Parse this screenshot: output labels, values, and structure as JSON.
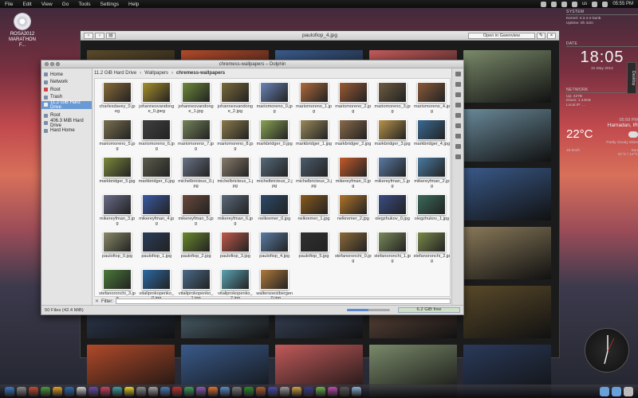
{
  "menubar": {
    "items": [
      "File",
      "Edit",
      "View",
      "Go",
      "Tools",
      "Settings",
      "Help"
    ],
    "kbd_layout": "us",
    "clock": "05:55 PM"
  },
  "desktop_icon": {
    "label": "ROSA2012 MARATHON F..."
  },
  "gwenview": {
    "title": "paulofiop_4.jpg",
    "open_button": "Open in Gwenview"
  },
  "dolphin": {
    "title": "chremess-wallpapers – Dolphin",
    "places": [
      {
        "label": "Home",
        "selected": false
      },
      {
        "label": "Network",
        "selected": false
      },
      {
        "label": "Root",
        "selected": false
      },
      {
        "label": "Trash",
        "selected": false
      },
      {
        "label": "11.2 GiB Hard Drive",
        "selected": true
      },
      {
        "label": "Root",
        "selected": false
      },
      {
        "label": "406.3 MiB Hard Drive",
        "selected": false
      },
      {
        "label": "Hard Home",
        "selected": false
      }
    ],
    "breadcrumb": [
      "11.2 GiB Hard Drive",
      "Wallpapers",
      "chremess-wallpapers"
    ],
    "files": [
      "charlesdavey_0.jpeg",
      "johannesvandonge_0.jpeg",
      "johannesvandonge_1.jpg",
      "johannesvandonge_2.jpg",
      "mariomoreno_0.jpg",
      "mariomoreno_1.jpg",
      "mariomoreno_2.jpg",
      "mariomoreno_3.jpg",
      "mariomoreno_4.jpg",
      "mariomoreno_5.jpg",
      "mariomoreno_6.jpg",
      "mariomoreno_7.jpg",
      "mariomoreno_8.jpg",
      "markbridger_0.jpg",
      "markbridger_1.jpg",
      "markbridger_2.jpg",
      "markbridger_3.jpg",
      "markbridger_4.jpg",
      "markbridger_5.jpg",
      "markbridger_6.jpg",
      "michelbricteux_0.jpg",
      "michelbricteux_1.jpg",
      "michelbricteux_2.jpg",
      "michelbricteux_3.jpg",
      "mikereyfman_0.jpg",
      "mikereyfman_1.jpg",
      "mikereyfman_2.jpg",
      "mikereyfman_3.jpg",
      "mikereyfman_4.jpg",
      "mikereyfman_5.jpg",
      "mikereyfman_6.jpg",
      "nelkremer_0.jpg",
      "nelkremer_1.jpg",
      "nelkremer_2.jpg",
      "olegzhukov_0.jpg",
      "olegzhukov_1.jpg",
      "paulofiop_0.jpg",
      "paulofiop_1.jpg",
      "paulofiop_2.jpg",
      "paulofiop_3.jpg",
      "paulofiop_4.jpg",
      "paulofiop_5.jpg",
      "stefanoronchi_0.jpg",
      "stefanoronchi_1.jpg",
      "stefanoronchi_2.jpg",
      "stefanoronchi_3.jpg",
      "vitaliprokopenko_0.jpg",
      "vitaliprokopenko_1.jpg",
      "vitaliprokopenko_2.jpg",
      "waltersoestbergen_0.jpg"
    ],
    "filter_label": "Filter:",
    "status_left": "50 Files (42.4 MiB)",
    "status_right": "6.2 GiB free"
  },
  "widgets": {
    "system_title": "SYSTEM",
    "system_lines": [
      "Kernel:  3.3.4-2-lamb",
      "Uptime:  0h 42m"
    ],
    "date_title": "DATE",
    "clock": "18:05",
    "date_line": "31 May 2012",
    "network_title": "NETWORK",
    "net_lines": [
      "Up: 427B",
      "Down: 1.44KB",
      "Local IP: ..."
    ],
    "location": "Hamadan, IR",
    "time_small": "05:59 PM",
    "temperature": "22°C",
    "condition": "Partly cloudy skies",
    "wind": "15 km/h",
    "forecast_day": "Sun",
    "forecast_temp": "21°C / 12°C",
    "desktop_tab": "Desktop"
  },
  "colors": {
    "selection": "#6a9ad4",
    "thumbnails": [
      "#8a6a3a",
      "#a8902c",
      "#6e8a3a",
      "#7a6a3a",
      "#6a84b8",
      "#b06a3a",
      "#9a5a34",
      "#6e5c40",
      "#8a5a3a",
      "#7a7050",
      "#404040",
      "#74845a",
      "#8a7a4a",
      "#8aa454",
      "#9a8a5a",
      "#8a6a4a",
      "#b8944a",
      "#3a6a94",
      "#7c8a3c",
      "#5c5c4c",
      "#6a7486",
      "#8a7c6c",
      "#566a7a",
      "#4c5c6c",
      "#c45a2a",
      "#5a7aa4",
      "#4a7aa0",
      "#6a6c8a",
      "#3a5aa4",
      "#6a4a3c",
      "#5a6a7a",
      "#2c4a6c",
      "#8a5a1c",
      "#b0742a",
      "#3a4c84",
      "#3a6a5a",
      "#8a8a6a",
      "#2a3c5a",
      "#6a8a2c",
      "#c05a4a",
      "#5a7ca4",
      "#303030",
      "#8a6a3a",
      "#7a8a5a",
      "#7a8a4a",
      "#4a7a3a",
      "#2a6aa4",
      "#4a6a8a",
      "#5aa4b4",
      "#b07a3a"
    ]
  }
}
